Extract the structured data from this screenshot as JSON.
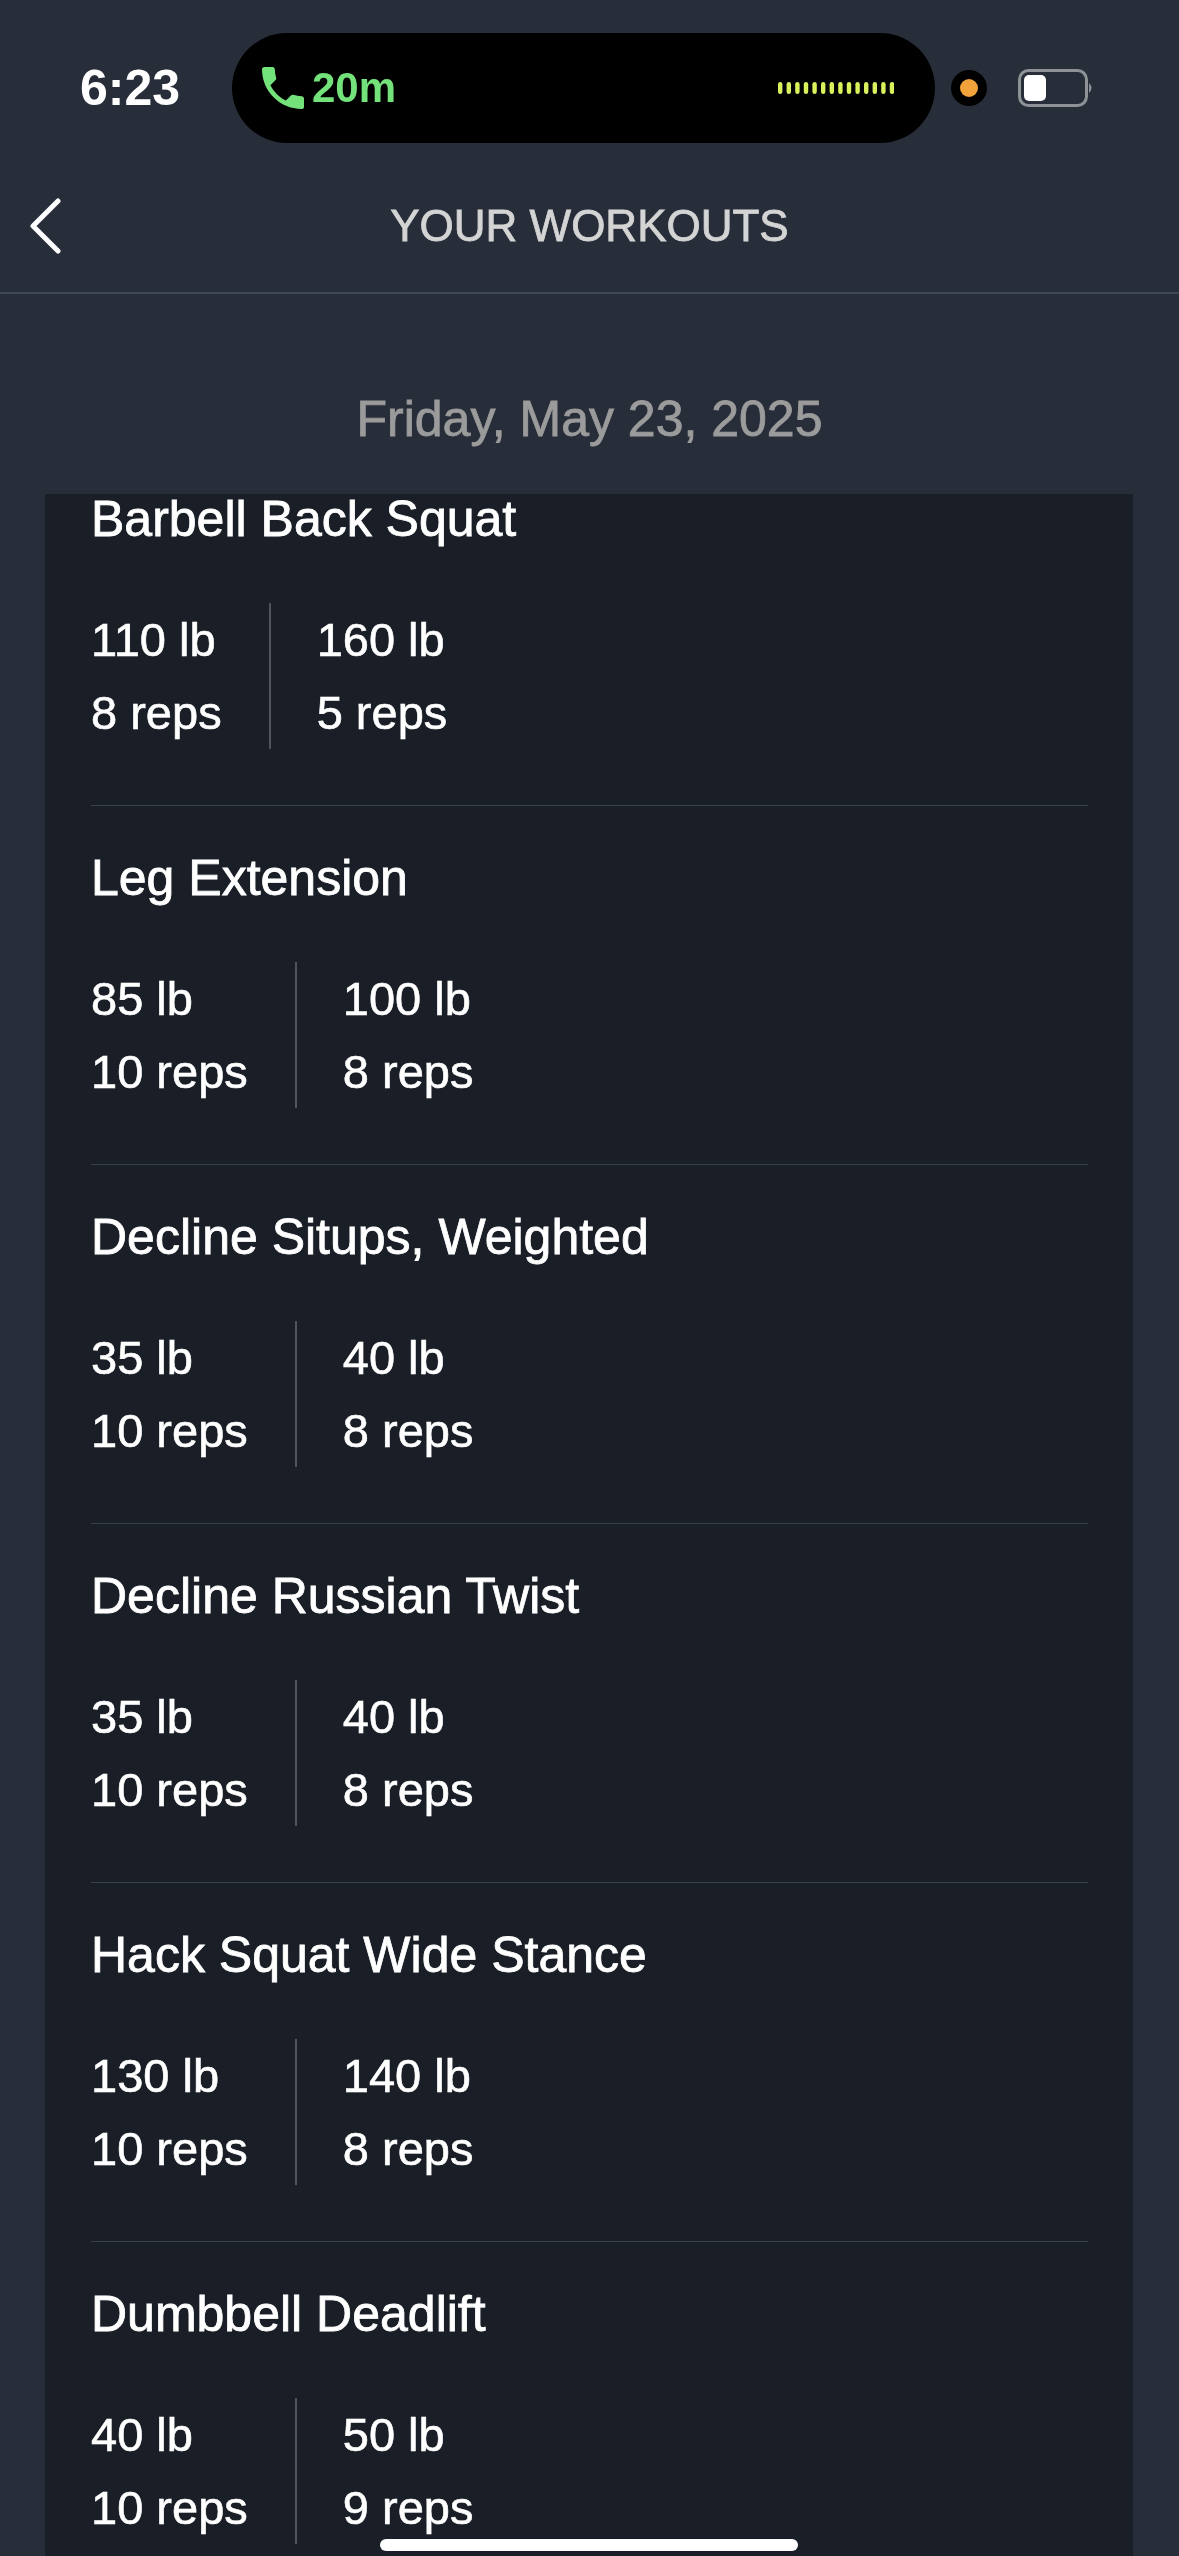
{
  "status_bar": {
    "time": "6:23",
    "call_duration": "20m"
  },
  "header": {
    "title": "YOUR WORKOUTS"
  },
  "date": "Friday, May 23, 2025",
  "exercises": [
    {
      "name": "Barbell Back Squat",
      "sets": [
        {
          "weight": "110 lb",
          "reps": "8 reps"
        },
        {
          "weight": "160 lb",
          "reps": "5 reps"
        }
      ]
    },
    {
      "name": "Leg Extension",
      "sets": [
        {
          "weight": "85 lb",
          "reps": "10 reps"
        },
        {
          "weight": "100 lb",
          "reps": "8 reps"
        }
      ]
    },
    {
      "name": "Decline Situps, Weighted",
      "sets": [
        {
          "weight": "35 lb",
          "reps": "10 reps"
        },
        {
          "weight": "40 lb",
          "reps": "8 reps"
        }
      ]
    },
    {
      "name": "Decline Russian Twist",
      "sets": [
        {
          "weight": "35 lb",
          "reps": "10 reps"
        },
        {
          "weight": "40 lb",
          "reps": "8 reps"
        }
      ]
    },
    {
      "name": "Hack Squat Wide Stance",
      "sets": [
        {
          "weight": "130 lb",
          "reps": "10 reps"
        },
        {
          "weight": "140 lb",
          "reps": "8 reps"
        }
      ]
    },
    {
      "name": "Dumbbell Deadlift",
      "sets": [
        {
          "weight": "40 lb",
          "reps": "10 reps"
        },
        {
          "weight": "50 lb",
          "reps": "9 reps"
        }
      ]
    }
  ]
}
